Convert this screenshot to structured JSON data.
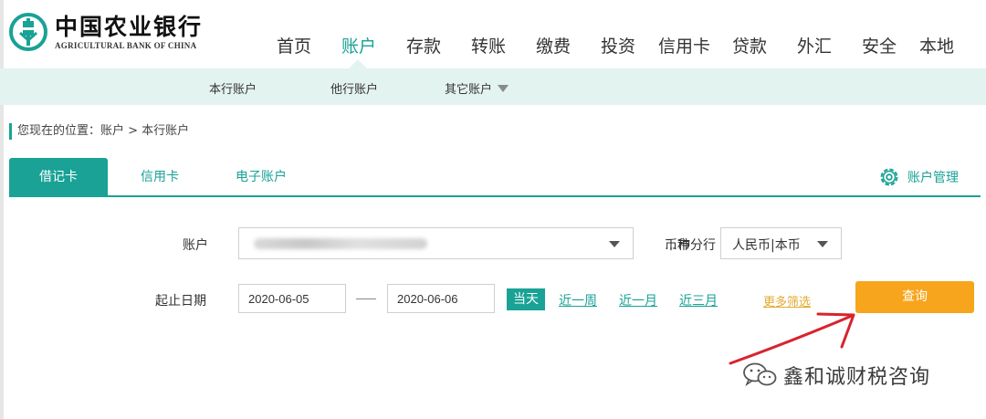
{
  "brand": {
    "name_cn": "中国农业银行",
    "name_en": "AGRICULTURAL BANK OF CHINA",
    "color": "#19a295"
  },
  "nav": {
    "items": [
      "首页",
      "账户",
      "存款",
      "转账",
      "缴费",
      "投资",
      "信用卡",
      "贷款",
      "外汇",
      "安全",
      "本地"
    ],
    "active": "账户"
  },
  "subnav": {
    "items": [
      "本行账户",
      "他行账户",
      "其它账户"
    ]
  },
  "breadcrumb": "您现在的位置：账户 > 本行账户",
  "tabs": {
    "items": [
      "借记卡",
      "信用卡",
      "电子账户"
    ],
    "active": "借记卡",
    "account_manage": "账户管理"
  },
  "form": {
    "account_label": "账户",
    "account_value": "…市分行",
    "currency_label": "币种",
    "currency_value": "人民币|本币",
    "date_label": "起止日期",
    "start_date": "2020-06-05",
    "end_date": "2020-06-06",
    "today_label": "当天",
    "quick_ranges": [
      "近一周",
      "近一月",
      "近三月"
    ],
    "more_filters": "更多筛选",
    "query_label": "查询",
    "query_color": "#f7a51c"
  },
  "watermark": {
    "text": "鑫和诚财税咨询",
    "icon": "wechat-icon"
  },
  "annotation": {
    "arrow_color": "#d9232d"
  }
}
